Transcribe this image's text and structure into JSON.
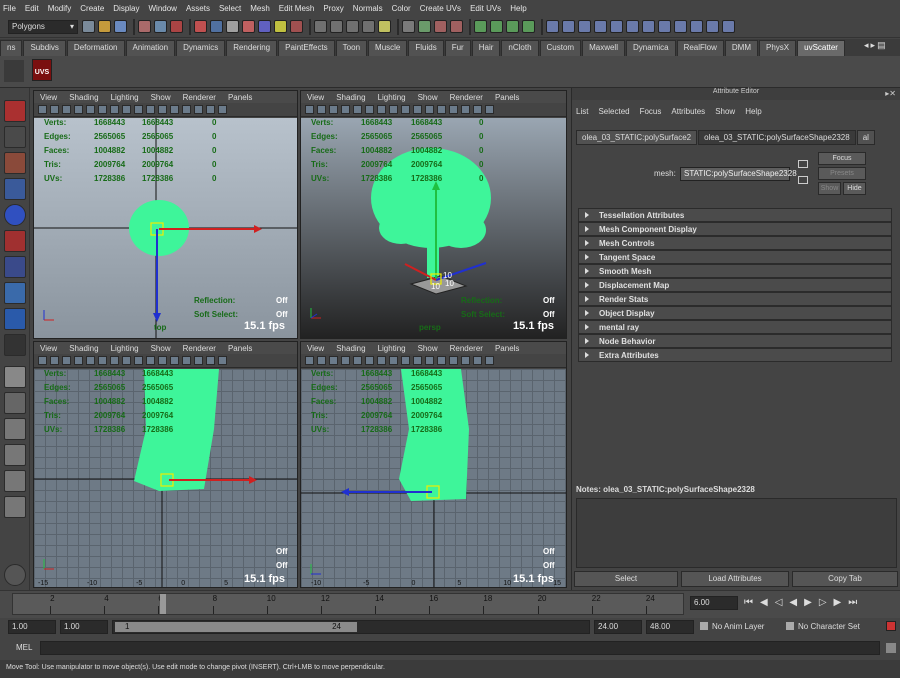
{
  "menu": [
    "File",
    "Edit",
    "Modify",
    "Create",
    "Display",
    "Window",
    "Assets",
    "Select",
    "Mesh",
    "Edit Mesh",
    "Proxy",
    "Normals",
    "Color",
    "Create UVs",
    "Edit UVs",
    "Help"
  ],
  "mode_select": "Polygons",
  "shelf_tabs": [
    "ns",
    "Subdivs",
    "Deformation",
    "Animation",
    "Dynamics",
    "Rendering",
    "PaintEffects",
    "Toon",
    "Muscle",
    "Fluids",
    "Fur",
    "Hair",
    "nCloth",
    "Custom",
    "Maxwell",
    "Dynamica",
    "RealFlow",
    "DMM",
    "PhysX",
    "uvScatter"
  ],
  "shelf_item": "UVS",
  "viewport_menu": [
    "View",
    "Shading",
    "Lighting",
    "Show",
    "Renderer",
    "Panels"
  ],
  "hud": {
    "labels": [
      "Verts:",
      "Edges:",
      "Faces:",
      "Tris:",
      "UVs:"
    ],
    "col1": [
      "1668443",
      "2565065",
      "1004882",
      "2009764",
      "1728386"
    ],
    "col2": [
      "1668443",
      "2565065",
      "1004882",
      "2009764",
      "1728386"
    ],
    "col3": [
      "0",
      "0",
      "0",
      "0",
      "0"
    ],
    "reflection_label": "Reflection:",
    "reflection_value": "Off",
    "softselect_label": "Soft Select:",
    "softselect_value": "Off",
    "fps": "15.1 fps"
  },
  "cameras": {
    "top": "top",
    "persp": "persp"
  },
  "manip_labels": [
    "10",
    "10",
    "10"
  ],
  "grid_ticks": [
    "-15",
    "-10",
    "-5",
    "0",
    "5",
    "10",
    "15"
  ],
  "colors": {
    "foliage": "#3ef59a",
    "manip_x": "#d02020",
    "manip_y": "#20c040",
    "manip_z": "#2030d0",
    "hud_green": "#176b17"
  },
  "attr_editor": {
    "title": "Attribute Editor",
    "menu": [
      "List",
      "Selected",
      "Focus",
      "Attributes",
      "Show",
      "Help"
    ],
    "tabs": [
      "olea_03_STATIC:polySurface2",
      "olea_03_STATIC:polySurfaceShape2328",
      "al"
    ],
    "mesh_label": "mesh:",
    "mesh_value": "STATIC:polySurfaceShape2328",
    "focus": "Focus",
    "presets": "Presets",
    "show": "Show",
    "hide": "Hide",
    "sections": [
      "Tessellation Attributes",
      "Mesh Component Display",
      "Mesh Controls",
      "Tangent Space",
      "Smooth Mesh",
      "Displacement Map",
      "Render Stats",
      "Object Display",
      "mental ray",
      "Node Behavior",
      "Extra Attributes"
    ],
    "notes": "Notes:  olea_03_STATIC:polySurfaceShape2328",
    "buttons": [
      "Select",
      "Load Attributes",
      "Copy Tab"
    ]
  },
  "timeline": {
    "ticks": [
      "2",
      "4",
      "6",
      "8",
      "10",
      "12",
      "14",
      "16",
      "18",
      "20",
      "22",
      "24"
    ],
    "current": "6.00"
  },
  "range": {
    "start": "1.00",
    "start2": "1.00",
    "slider_start": "1",
    "slider_end": "24",
    "end1": "24.00",
    "end2": "48.00",
    "anim_layer": "No Anim Layer",
    "char_set": "No Character Set"
  },
  "cmd": {
    "label": "MEL"
  },
  "help": "Move Tool: Use manipulator to move object(s). Use edit mode to change pivot (INSERT). Ctrl+LMB to move perpendicular."
}
